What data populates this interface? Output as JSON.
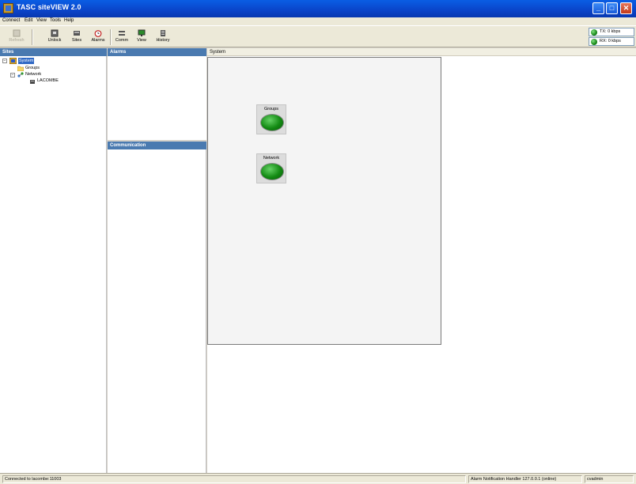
{
  "window": {
    "title": "TASC siteVIEW 2.0",
    "controls": {
      "minimize": "_",
      "maximize": "□",
      "close": "✕"
    }
  },
  "menu": [
    "Connect",
    "Edit",
    "View",
    "Tools",
    "Help"
  ],
  "toolbar": {
    "buttons": [
      {
        "label": "Refresh",
        "icon": "refresh-icon",
        "enabled": false
      },
      {
        "label": "Unlock",
        "icon": "unlock-icon",
        "enabled": true
      },
      {
        "label": "Sites",
        "icon": "sites-icon",
        "enabled": true
      },
      {
        "label": "Alarms",
        "icon": "alarm-clock-icon",
        "enabled": true
      },
      {
        "label": "Comm",
        "icon": "comm-icon",
        "enabled": true
      },
      {
        "label": "View",
        "icon": "view-icon",
        "enabled": true
      },
      {
        "label": "History",
        "icon": "history-icon",
        "enabled": true
      }
    ]
  },
  "rates": {
    "tx": "TX: 0 kbps",
    "rx": "RX: 0 kbps"
  },
  "panes": {
    "sites": "Sites",
    "alarms": "Alarms",
    "communication": "Communication",
    "system": "System"
  },
  "tree": {
    "root": "System",
    "groups": "Groups",
    "network": "Network",
    "site": "LACOMBE"
  },
  "nodes": [
    {
      "label": "Groups",
      "status": "green"
    },
    {
      "label": "Network",
      "status": "green"
    }
  ],
  "statusbar": {
    "connection": "Connected to lacombe:11003",
    "handler": "Alarm Notification Handler 127.0.0.1 (online)",
    "user": "cvadmin"
  },
  "colors": {
    "title_bar": "#0a44c9",
    "pane_header": "#4a7ab0",
    "status_ok": "#138a13",
    "selection": "#316ac5"
  }
}
